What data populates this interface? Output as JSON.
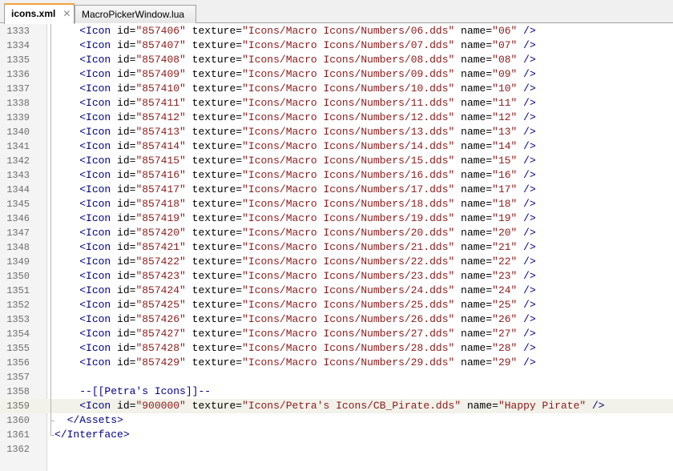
{
  "tabs": [
    {
      "label": "icons.xml",
      "active": true,
      "close": "✕"
    },
    {
      "label": "MacroPickerWindow.lua",
      "active": false
    }
  ],
  "editor": {
    "colors": {
      "tag": "#000080",
      "value": "#8b1a1a",
      "gutter_bg": "#f4f4f4",
      "current_line_bg": "#f2f2ea",
      "active_tab_accent": "#f3a33a"
    },
    "lines": [
      {
        "num": "1333",
        "kind": "icon",
        "id": "857406",
        "texture": "Icons/Macro Icons/Numbers/06.dds",
        "name": "06"
      },
      {
        "num": "1334",
        "kind": "icon",
        "id": "857407",
        "texture": "Icons/Macro Icons/Numbers/07.dds",
        "name": "07"
      },
      {
        "num": "1335",
        "kind": "icon",
        "id": "857408",
        "texture": "Icons/Macro Icons/Numbers/08.dds",
        "name": "08"
      },
      {
        "num": "1336",
        "kind": "icon",
        "id": "857409",
        "texture": "Icons/Macro Icons/Numbers/09.dds",
        "name": "09"
      },
      {
        "num": "1337",
        "kind": "icon",
        "id": "857410",
        "texture": "Icons/Macro Icons/Numbers/10.dds",
        "name": "10"
      },
      {
        "num": "1338",
        "kind": "icon",
        "id": "857411",
        "texture": "Icons/Macro Icons/Numbers/11.dds",
        "name": "11"
      },
      {
        "num": "1339",
        "kind": "icon",
        "id": "857412",
        "texture": "Icons/Macro Icons/Numbers/12.dds",
        "name": "12"
      },
      {
        "num": "1340",
        "kind": "icon",
        "id": "857413",
        "texture": "Icons/Macro Icons/Numbers/13.dds",
        "name": "13"
      },
      {
        "num": "1341",
        "kind": "icon",
        "id": "857414",
        "texture": "Icons/Macro Icons/Numbers/14.dds",
        "name": "14"
      },
      {
        "num": "1342",
        "kind": "icon",
        "id": "857415",
        "texture": "Icons/Macro Icons/Numbers/15.dds",
        "name": "15"
      },
      {
        "num": "1343",
        "kind": "icon",
        "id": "857416",
        "texture": "Icons/Macro Icons/Numbers/16.dds",
        "name": "16"
      },
      {
        "num": "1344",
        "kind": "icon",
        "id": "857417",
        "texture": "Icons/Macro Icons/Numbers/17.dds",
        "name": "17"
      },
      {
        "num": "1345",
        "kind": "icon",
        "id": "857418",
        "texture": "Icons/Macro Icons/Numbers/18.dds",
        "name": "18"
      },
      {
        "num": "1346",
        "kind": "icon",
        "id": "857419",
        "texture": "Icons/Macro Icons/Numbers/19.dds",
        "name": "19"
      },
      {
        "num": "1347",
        "kind": "icon",
        "id": "857420",
        "texture": "Icons/Macro Icons/Numbers/20.dds",
        "name": "20"
      },
      {
        "num": "1348",
        "kind": "icon",
        "id": "857421",
        "texture": "Icons/Macro Icons/Numbers/21.dds",
        "name": "21"
      },
      {
        "num": "1349",
        "kind": "icon",
        "id": "857422",
        "texture": "Icons/Macro Icons/Numbers/22.dds",
        "name": "22"
      },
      {
        "num": "1350",
        "kind": "icon",
        "id": "857423",
        "texture": "Icons/Macro Icons/Numbers/23.dds",
        "name": "23"
      },
      {
        "num": "1351",
        "kind": "icon",
        "id": "857424",
        "texture": "Icons/Macro Icons/Numbers/24.dds",
        "name": "24"
      },
      {
        "num": "1352",
        "kind": "icon",
        "id": "857425",
        "texture": "Icons/Macro Icons/Numbers/25.dds",
        "name": "25"
      },
      {
        "num": "1353",
        "kind": "icon",
        "id": "857426",
        "texture": "Icons/Macro Icons/Numbers/26.dds",
        "name": "26"
      },
      {
        "num": "1354",
        "kind": "icon",
        "id": "857427",
        "texture": "Icons/Macro Icons/Numbers/27.dds",
        "name": "27"
      },
      {
        "num": "1355",
        "kind": "icon",
        "id": "857428",
        "texture": "Icons/Macro Icons/Numbers/28.dds",
        "name": "28"
      },
      {
        "num": "1356",
        "kind": "icon",
        "id": "857429",
        "texture": "Icons/Macro Icons/Numbers/29.dds",
        "name": "29"
      },
      {
        "num": "1357",
        "kind": "blank"
      },
      {
        "num": "1358",
        "kind": "comment",
        "text": "--[[Petra's Icons]]--"
      },
      {
        "num": "1359",
        "kind": "icon",
        "id": "900000",
        "texture": "Icons/Petra's Icons/CB_Pirate.dds",
        "name": "Happy Pirate",
        "current": true
      },
      {
        "num": "1360",
        "kind": "close",
        "text": "</Assets>",
        "indent": 2
      },
      {
        "num": "1361",
        "kind": "close",
        "text": "</Interface>",
        "indent": 0
      },
      {
        "num": "1362",
        "kind": "blank"
      }
    ]
  }
}
